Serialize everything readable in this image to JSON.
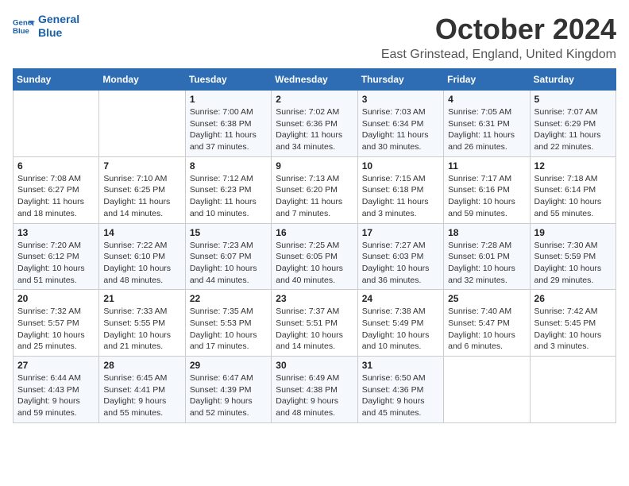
{
  "logo": {
    "line1": "General",
    "line2": "Blue"
  },
  "title": "October 2024",
  "location": "East Grinstead, England, United Kingdom",
  "weekdays": [
    "Sunday",
    "Monday",
    "Tuesday",
    "Wednesday",
    "Thursday",
    "Friday",
    "Saturday"
  ],
  "weeks": [
    [
      {
        "day": "",
        "info": ""
      },
      {
        "day": "",
        "info": ""
      },
      {
        "day": "1",
        "info": "Sunrise: 7:00 AM\nSunset: 6:38 PM\nDaylight: 11 hours\nand 37 minutes."
      },
      {
        "day": "2",
        "info": "Sunrise: 7:02 AM\nSunset: 6:36 PM\nDaylight: 11 hours\nand 34 minutes."
      },
      {
        "day": "3",
        "info": "Sunrise: 7:03 AM\nSunset: 6:34 PM\nDaylight: 11 hours\nand 30 minutes."
      },
      {
        "day": "4",
        "info": "Sunrise: 7:05 AM\nSunset: 6:31 PM\nDaylight: 11 hours\nand 26 minutes."
      },
      {
        "day": "5",
        "info": "Sunrise: 7:07 AM\nSunset: 6:29 PM\nDaylight: 11 hours\nand 22 minutes."
      }
    ],
    [
      {
        "day": "6",
        "info": "Sunrise: 7:08 AM\nSunset: 6:27 PM\nDaylight: 11 hours\nand 18 minutes."
      },
      {
        "day": "7",
        "info": "Sunrise: 7:10 AM\nSunset: 6:25 PM\nDaylight: 11 hours\nand 14 minutes."
      },
      {
        "day": "8",
        "info": "Sunrise: 7:12 AM\nSunset: 6:23 PM\nDaylight: 11 hours\nand 10 minutes."
      },
      {
        "day": "9",
        "info": "Sunrise: 7:13 AM\nSunset: 6:20 PM\nDaylight: 11 hours\nand 7 minutes."
      },
      {
        "day": "10",
        "info": "Sunrise: 7:15 AM\nSunset: 6:18 PM\nDaylight: 11 hours\nand 3 minutes."
      },
      {
        "day": "11",
        "info": "Sunrise: 7:17 AM\nSunset: 6:16 PM\nDaylight: 10 hours\nand 59 minutes."
      },
      {
        "day": "12",
        "info": "Sunrise: 7:18 AM\nSunset: 6:14 PM\nDaylight: 10 hours\nand 55 minutes."
      }
    ],
    [
      {
        "day": "13",
        "info": "Sunrise: 7:20 AM\nSunset: 6:12 PM\nDaylight: 10 hours\nand 51 minutes."
      },
      {
        "day": "14",
        "info": "Sunrise: 7:22 AM\nSunset: 6:10 PM\nDaylight: 10 hours\nand 48 minutes."
      },
      {
        "day": "15",
        "info": "Sunrise: 7:23 AM\nSunset: 6:07 PM\nDaylight: 10 hours\nand 44 minutes."
      },
      {
        "day": "16",
        "info": "Sunrise: 7:25 AM\nSunset: 6:05 PM\nDaylight: 10 hours\nand 40 minutes."
      },
      {
        "day": "17",
        "info": "Sunrise: 7:27 AM\nSunset: 6:03 PM\nDaylight: 10 hours\nand 36 minutes."
      },
      {
        "day": "18",
        "info": "Sunrise: 7:28 AM\nSunset: 6:01 PM\nDaylight: 10 hours\nand 32 minutes."
      },
      {
        "day": "19",
        "info": "Sunrise: 7:30 AM\nSunset: 5:59 PM\nDaylight: 10 hours\nand 29 minutes."
      }
    ],
    [
      {
        "day": "20",
        "info": "Sunrise: 7:32 AM\nSunset: 5:57 PM\nDaylight: 10 hours\nand 25 minutes."
      },
      {
        "day": "21",
        "info": "Sunrise: 7:33 AM\nSunset: 5:55 PM\nDaylight: 10 hours\nand 21 minutes."
      },
      {
        "day": "22",
        "info": "Sunrise: 7:35 AM\nSunset: 5:53 PM\nDaylight: 10 hours\nand 17 minutes."
      },
      {
        "day": "23",
        "info": "Sunrise: 7:37 AM\nSunset: 5:51 PM\nDaylight: 10 hours\nand 14 minutes."
      },
      {
        "day": "24",
        "info": "Sunrise: 7:38 AM\nSunset: 5:49 PM\nDaylight: 10 hours\nand 10 minutes."
      },
      {
        "day": "25",
        "info": "Sunrise: 7:40 AM\nSunset: 5:47 PM\nDaylight: 10 hours\nand 6 minutes."
      },
      {
        "day": "26",
        "info": "Sunrise: 7:42 AM\nSunset: 5:45 PM\nDaylight: 10 hours\nand 3 minutes."
      }
    ],
    [
      {
        "day": "27",
        "info": "Sunrise: 6:44 AM\nSunset: 4:43 PM\nDaylight: 9 hours\nand 59 minutes."
      },
      {
        "day": "28",
        "info": "Sunrise: 6:45 AM\nSunset: 4:41 PM\nDaylight: 9 hours\nand 55 minutes."
      },
      {
        "day": "29",
        "info": "Sunrise: 6:47 AM\nSunset: 4:39 PM\nDaylight: 9 hours\nand 52 minutes."
      },
      {
        "day": "30",
        "info": "Sunrise: 6:49 AM\nSunset: 4:38 PM\nDaylight: 9 hours\nand 48 minutes."
      },
      {
        "day": "31",
        "info": "Sunrise: 6:50 AM\nSunset: 4:36 PM\nDaylight: 9 hours\nand 45 minutes."
      },
      {
        "day": "",
        "info": ""
      },
      {
        "day": "",
        "info": ""
      }
    ]
  ]
}
